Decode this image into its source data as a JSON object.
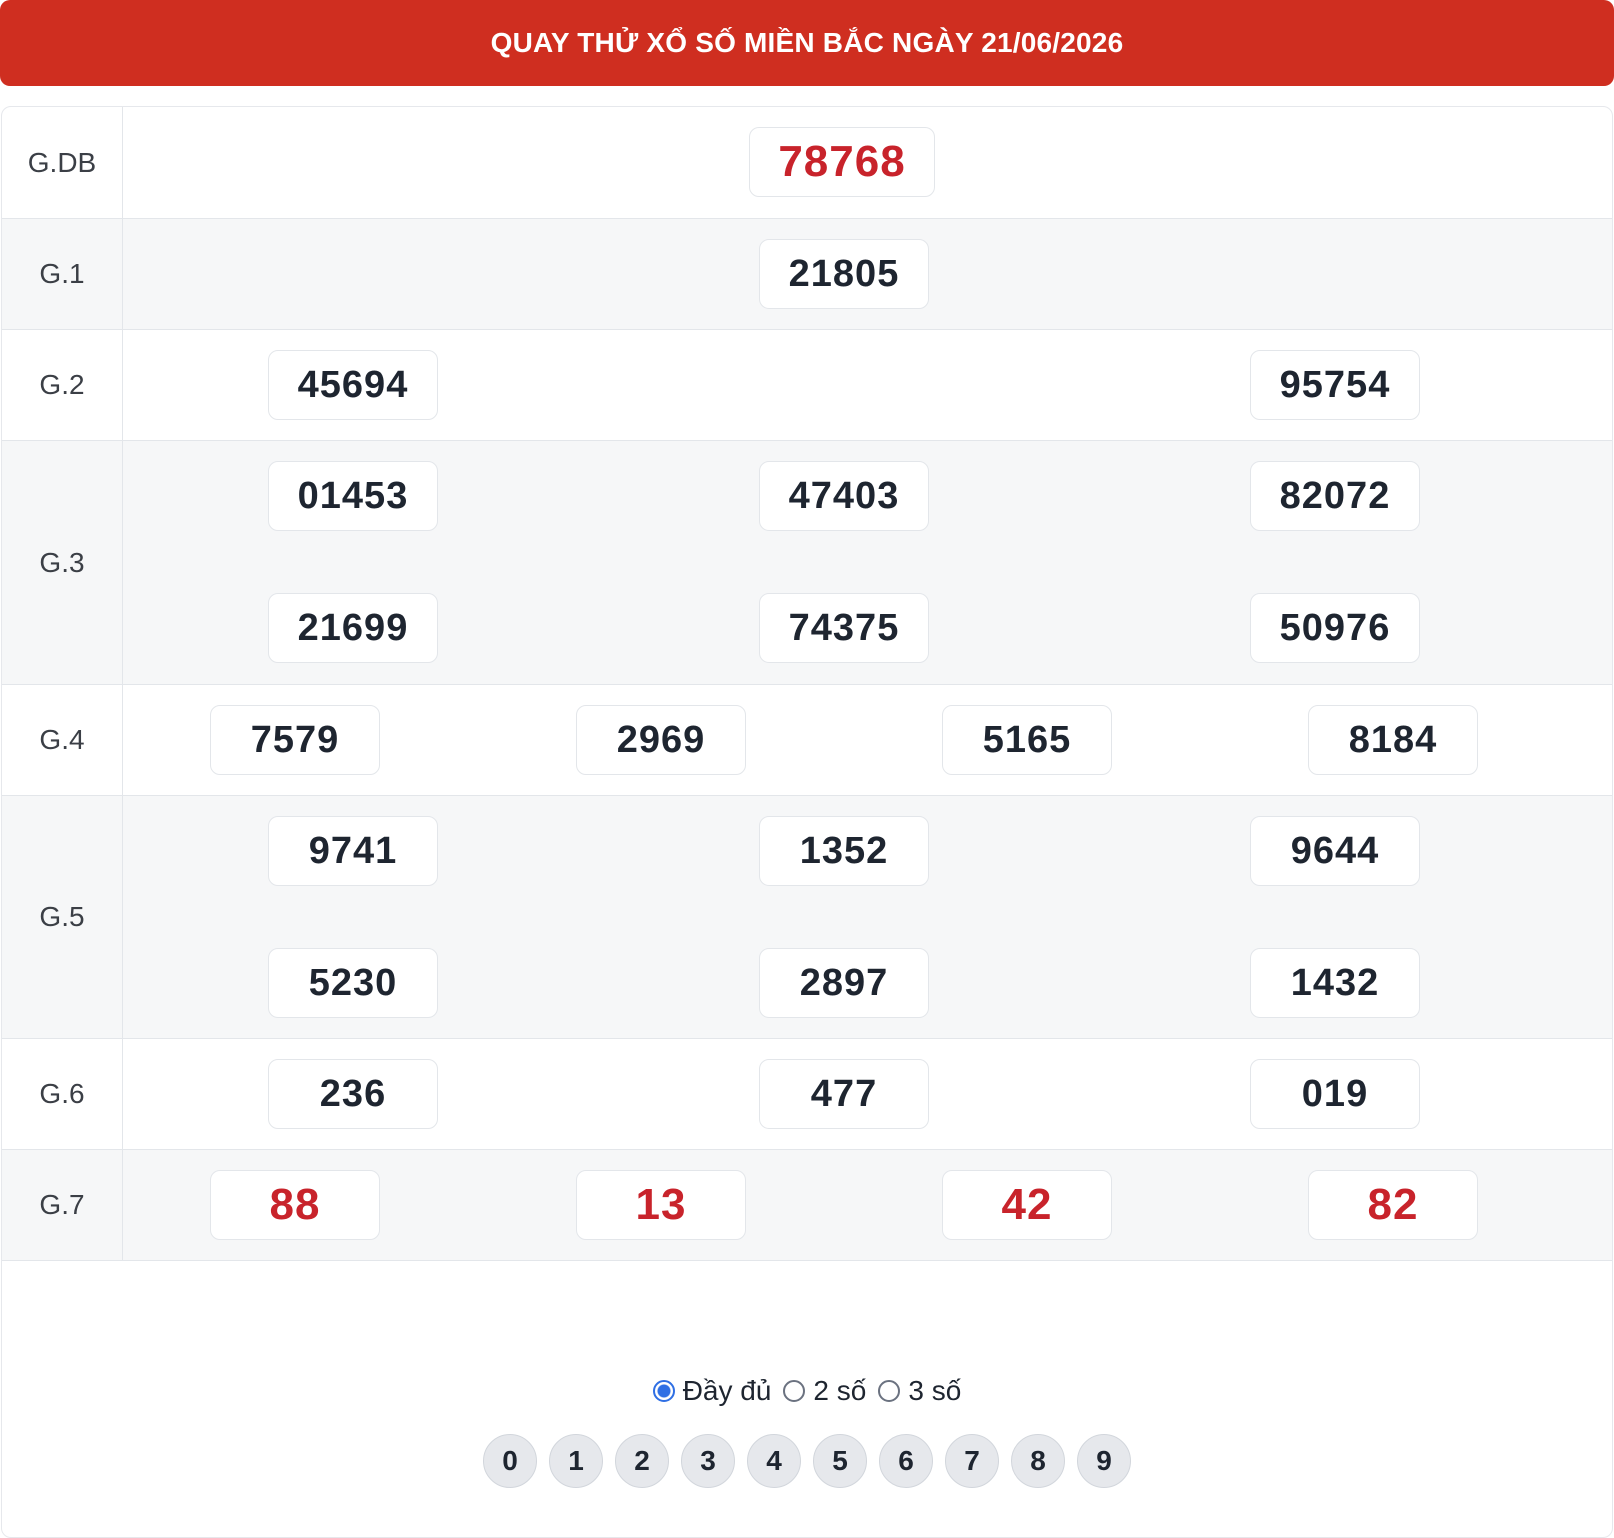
{
  "header": {
    "title": "QUAY THỬ XỔ SỐ MIỀN BẮC NGÀY 21/06/2026"
  },
  "prizes": {
    "gdb": {
      "label": "G.DB",
      "numbers": [
        "78768"
      ]
    },
    "g1": {
      "label": "G.1",
      "numbers": [
        "21805"
      ]
    },
    "g2": {
      "label": "G.2",
      "numbers": [
        "45694",
        "95754"
      ]
    },
    "g3": {
      "label": "G.3",
      "numbers": [
        "01453",
        "47403",
        "82072",
        "21699",
        "74375",
        "50976"
      ]
    },
    "g4": {
      "label": "G.4",
      "numbers": [
        "7579",
        "2969",
        "5165",
        "8184"
      ]
    },
    "g5": {
      "label": "G.5",
      "numbers": [
        "9741",
        "1352",
        "9644",
        "5230",
        "2897",
        "1432"
      ]
    },
    "g6": {
      "label": "G.6",
      "numbers": [
        "236",
        "477",
        "019"
      ]
    },
    "g7": {
      "label": "G.7",
      "numbers": [
        "88",
        "13",
        "42",
        "82"
      ]
    }
  },
  "display_options": {
    "selected": "full",
    "items": [
      {
        "id": "full",
        "label": "Đầy đủ"
      },
      {
        "id": "two",
        "label": "2 số"
      },
      {
        "id": "three",
        "label": "3 số"
      }
    ]
  },
  "digit_filters": [
    "0",
    "1",
    "2",
    "3",
    "4",
    "5",
    "6",
    "7",
    "8",
    "9"
  ],
  "colors": {
    "header_bg": "#cf2e20",
    "special_number": "#c8232b",
    "radio_selected": "#2f6fe4"
  }
}
